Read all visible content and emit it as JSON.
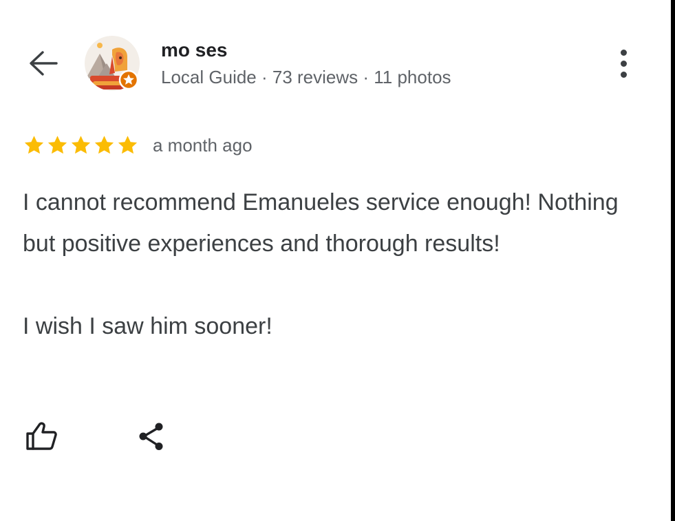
{
  "header": {
    "back_icon": "arrow-left-icon",
    "more_icon": "more-vertical-icon"
  },
  "reviewer": {
    "name": "mo ses",
    "meta": "Local Guide · 73 reviews · 11 photos",
    "avatar_icon": "sphinx-avatar",
    "badge_icon": "local-guide-star-badge"
  },
  "review": {
    "rating": 5,
    "max_rating": 5,
    "time": "a month ago",
    "paragraph1": "I cannot recommend Emanueles service enough! Nothing but positive experiences and thorough results!",
    "paragraph2": "I wish I saw him sooner!"
  },
  "actions": {
    "like_icon": "thumb-up-icon",
    "share_icon": "share-icon"
  },
  "colors": {
    "star": "#FBBC04",
    "text_primary": "#202124",
    "text_secondary": "#5f6368",
    "badge": "#E37400"
  }
}
